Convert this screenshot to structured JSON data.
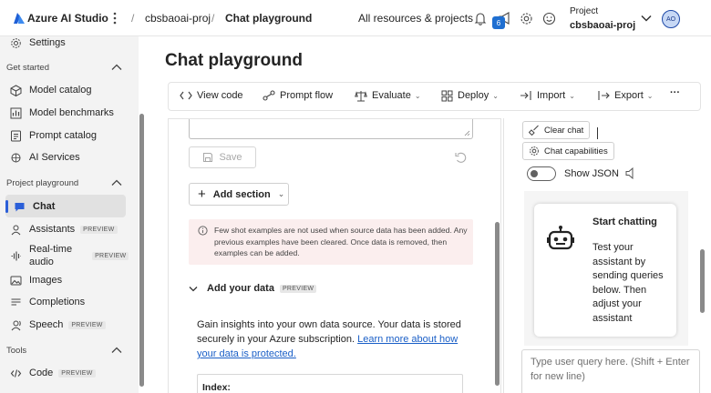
{
  "topbar": {
    "app_name": "Azure AI Studio",
    "project_crumb": "cbsbaoai-proj",
    "page_crumb": "Chat playground",
    "all_resources": "All resources & projects",
    "notification_count": "6",
    "project_label": "Project",
    "project_name": "cbsbaoai-proj",
    "avatar_initials": "AO"
  },
  "sidebar": {
    "settings": "Settings",
    "get_started": "Get started",
    "model_catalog": "Model catalog",
    "model_benchmarks": "Model benchmarks",
    "prompt_catalog": "Prompt catalog",
    "ai_services": "AI Services",
    "project_playground": "Project playground",
    "chat": "Chat",
    "assistants": "Assistants",
    "realtime_line1": "Real-time",
    "realtime_line2": "audio",
    "images": "Images",
    "completions": "Completions",
    "speech": "Speech",
    "tools": "Tools",
    "code": "Code",
    "preview_badge": "PREVIEW"
  },
  "main": {
    "title": "Chat playground",
    "toolbar": {
      "view_code": "View code",
      "prompt_flow": "Prompt flow",
      "evaluate": "Evaluate",
      "deploy": "Deploy",
      "import": "Import",
      "export": "Export",
      "more": "···"
    },
    "setup": {
      "save": "Save",
      "add_section": "Add section",
      "warning": "Few shot examples are not used when source data has been added. Any previous examples have been cleared. Once data is removed, then examples can be added.",
      "add_your_data": "Add your data",
      "preview_badge": "PREVIEW",
      "data_text": "Gain insights into your own data source. Your data is stored securely in your Azure subscription.",
      "data_link": "Learn more about how your data is protected.",
      "index_label": "Index:"
    },
    "chat": {
      "clear_chat": "Clear chat",
      "chat_capabilities": "Chat capabilities",
      "show_json": "Show JSON",
      "start_title": "Start chatting",
      "start_body": "Test your assistant by sending queries below. Then adjust your assistant",
      "query_placeholder": "Type user query here. (Shift + Enter for new line)"
    }
  },
  "colors": {
    "accent": "#2b5fd8",
    "link": "#1a5fc7",
    "sidebar_bg": "#f3f3f3",
    "warning_bg": "#fbeeee"
  }
}
